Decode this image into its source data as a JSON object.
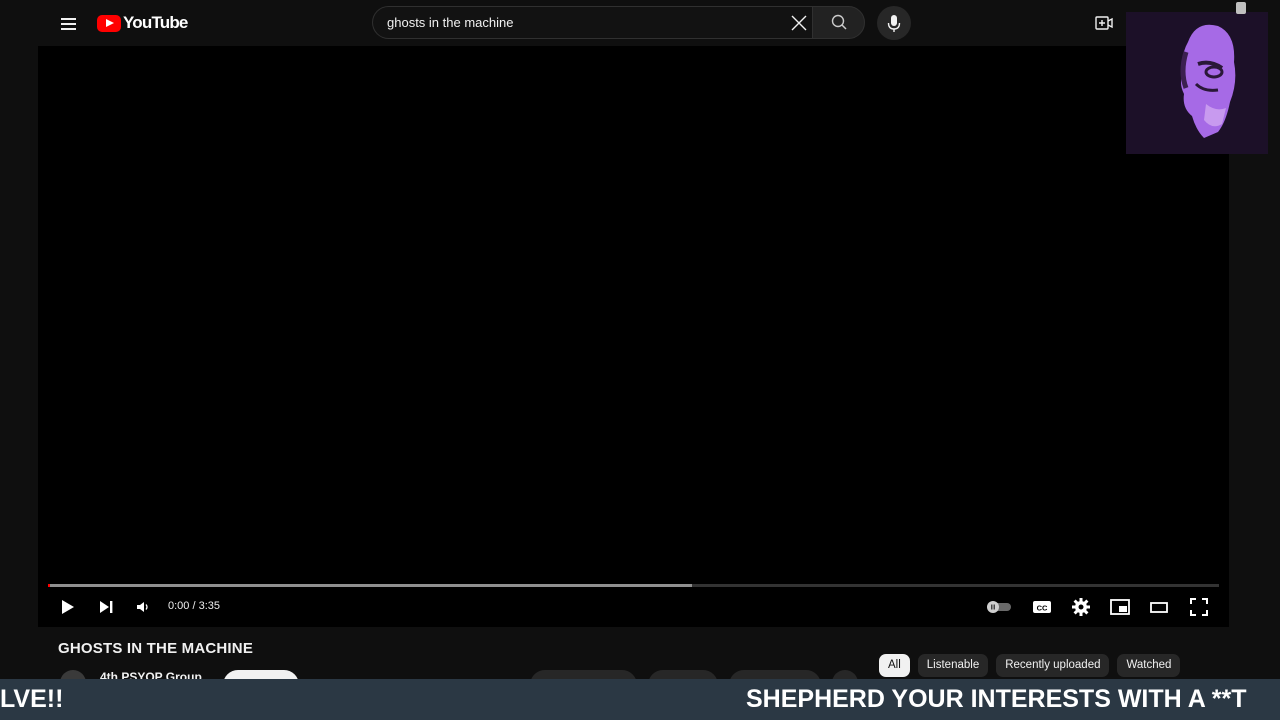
{
  "header": {
    "logo_text": "YouTube",
    "search_value": "ghosts in the machine"
  },
  "player": {
    "time": "0:00 / 3:35",
    "progress_fraction": 0.0,
    "buffered_fraction": 0.55
  },
  "video": {
    "title": "GHOSTS IN THE MACHINE",
    "channel": "4th PSYOP Group"
  },
  "chips": [
    "All",
    "Listenable",
    "Recently uploaded",
    "Watched"
  ],
  "ticker": {
    "left_text": "LVE!!",
    "right_text": "SHEPHERD YOUR INTERESTS WITH A **T"
  },
  "colors": {
    "brand": "#ff0000",
    "background": "#0f0f0f",
    "ticker_bg": "#2b3844"
  },
  "icons": {
    "menu": "hamburger-icon",
    "clear": "close-icon",
    "search": "search-icon",
    "mic": "microphone-icon",
    "create": "video-add-icon",
    "play": "play-icon",
    "next": "skip-next-icon",
    "volume": "volume-icon",
    "autoplay": "autoplay-toggle-icon",
    "captions": "captions-icon",
    "settings": "gear-icon",
    "miniplayer": "miniplayer-icon",
    "theater": "theater-mode-icon",
    "fullscreen": "fullscreen-icon"
  }
}
